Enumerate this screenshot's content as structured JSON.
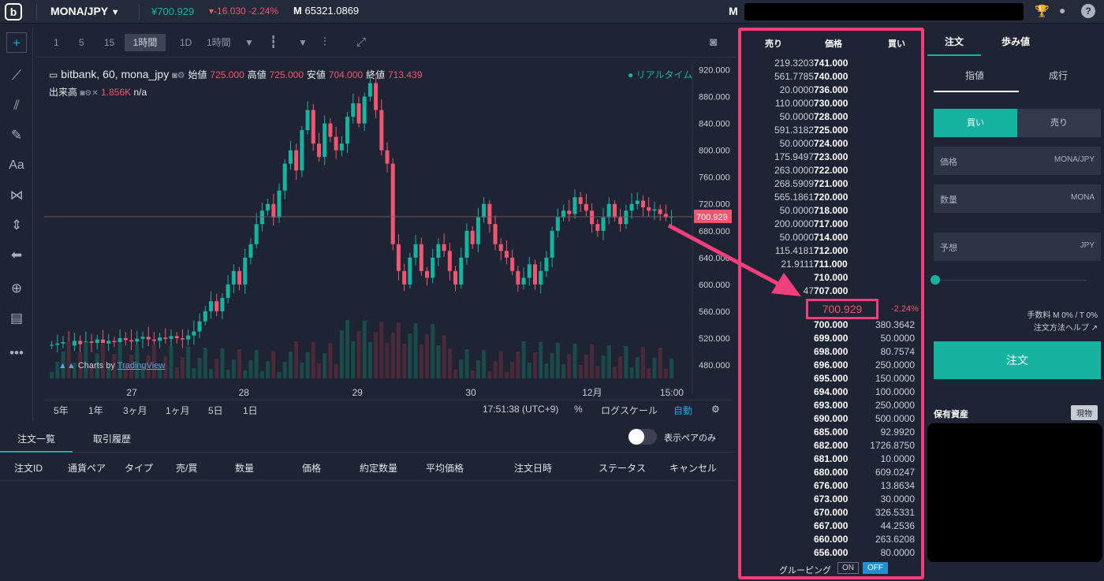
{
  "header": {
    "pair": "MONA/JPY",
    "price": "¥700.929",
    "change": "-16.030 -2.24%",
    "volume_prefix": "M",
    "volume": "65321.0869",
    "user_prefix": "M"
  },
  "chart_toolbar": {
    "timeframes": [
      "1",
      "5",
      "15",
      "1時間",
      "1D",
      "1時間"
    ],
    "active": "1時間"
  },
  "chart_legend": {
    "title": "bitbank, 60, mona_jpy",
    "open_label": "始値",
    "open": "725.000",
    "high_label": "高値",
    "high": "725.000",
    "low_label": "安値",
    "low": "704.000",
    "close_label": "終値",
    "close": "713.439",
    "volume_label": "出来高",
    "volume_value": "1.856K",
    "volume_extra": "n/a",
    "realtime": "● リアルタイム",
    "watermark": "Charts by",
    "watermark_link": "TradingView"
  },
  "chart_data": {
    "type": "candlestick",
    "y_ticks": [
      "920.000",
      "880.000",
      "840.000",
      "800.000",
      "760.000",
      "720.000",
      "680.000",
      "640.000",
      "600.000",
      "560.000",
      "520.000",
      "480.000"
    ],
    "ylim": [
      460,
      930
    ],
    "x_ticks": [
      "27",
      "28",
      "29",
      "30",
      "12月",
      "15:00"
    ],
    "current_price": "700.929",
    "closes": [
      510,
      512,
      514,
      509,
      516,
      511,
      515,
      513,
      518,
      512,
      516,
      514,
      520,
      517,
      515,
      519,
      522,
      518,
      516,
      521,
      519,
      523,
      520,
      518,
      524,
      530,
      545,
      560,
      575,
      560,
      580,
      600,
      620,
      600,
      640,
      660,
      690,
      710,
      720,
      700,
      740,
      780,
      800,
      770,
      830,
      860,
      810,
      790,
      840,
      820,
      800,
      810,
      850,
      870,
      840,
      880,
      900,
      860,
      800,
      780,
      660,
      620,
      600,
      640,
      660,
      620,
      610,
      640,
      660,
      650,
      620,
      600,
      640,
      680,
      660,
      700,
      720,
      690,
      660,
      650,
      640,
      620,
      600,
      610,
      630,
      600,
      620,
      640,
      680,
      700,
      710,
      705,
      730,
      720,
      710,
      690,
      680,
      700,
      720,
      700,
      690,
      710,
      720,
      725,
      715,
      710,
      712,
      705,
      700,
      701
    ]
  },
  "chart_bottom": {
    "ranges": [
      "5年",
      "1年",
      "3ヶ月",
      "1ヶ月",
      "5日",
      "1日"
    ],
    "clock": "17:51:38 (UTC+9)",
    "pct": "%",
    "log": "ログスケール",
    "auto": "自動"
  },
  "orders": {
    "tabs": [
      "注文一覧",
      "取引履歴"
    ],
    "toggle_label": "表示ペアのみ",
    "columns": [
      "注文ID",
      "通貨ペア",
      "タイプ",
      "売/買",
      "数量",
      "価格",
      "約定数量",
      "平均価格",
      "注文日時",
      "ステータス",
      "キャンセル"
    ]
  },
  "orderbook": {
    "headers": [
      "売り",
      "価格",
      "買い"
    ],
    "asks": [
      [
        "219.3203",
        "741.000"
      ],
      [
        "561.7785",
        "740.000"
      ],
      [
        "20.0000",
        "736.000"
      ],
      [
        "110.0000",
        "730.000"
      ],
      [
        "50.0000",
        "728.000"
      ],
      [
        "591.3182",
        "725.000"
      ],
      [
        "50.0000",
        "724.000"
      ],
      [
        "175.9497",
        "723.000"
      ],
      [
        "263.0000",
        "722.000"
      ],
      [
        "268.5909",
        "721.000"
      ],
      [
        "565.1861",
        "720.000"
      ],
      [
        "50.0000",
        "718.000"
      ],
      [
        "200.0000",
        "717.000"
      ],
      [
        "50.0000",
        "714.000"
      ],
      [
        "115.4181",
        "712.000"
      ],
      [
        "21.9111",
        "711.000"
      ],
      [
        "",
        "710.000"
      ],
      [
        "47",
        "707.000"
      ]
    ],
    "mid_price": "700.929",
    "mid_change": "-2.24%",
    "bids": [
      [
        "700.000",
        "380.3642"
      ],
      [
        "699.000",
        "50.0000"
      ],
      [
        "698.000",
        "80.7574"
      ],
      [
        "696.000",
        "250.0000"
      ],
      [
        "695.000",
        "150.0000"
      ],
      [
        "694.000",
        "100.0000"
      ],
      [
        "693.000",
        "250.0000"
      ],
      [
        "690.000",
        "500.0000"
      ],
      [
        "685.000",
        "92.9920"
      ],
      [
        "682.000",
        "1726.8750"
      ],
      [
        "681.000",
        "10.0000"
      ],
      [
        "680.000",
        "609.0247"
      ],
      [
        "676.000",
        "13.8634"
      ],
      [
        "673.000",
        "30.0000"
      ],
      [
        "670.000",
        "326.5331"
      ],
      [
        "667.000",
        "44.2536"
      ],
      [
        "660.000",
        "263.6208"
      ],
      [
        "656.000",
        "80.0000"
      ]
    ],
    "grouping_label": "グルーピング",
    "on": "ON",
    "off": "OFF"
  },
  "order_panel": {
    "tabs": [
      "注文",
      "歩み値"
    ],
    "subtabs": [
      "指値",
      "成行"
    ],
    "buy": "買い",
    "sell": "売り",
    "price_label": "価格",
    "price_unit": "MONA/JPY",
    "qty_label": "数量",
    "qty_unit": "MONA",
    "est_label": "予想",
    "est_unit": "JPY",
    "fee": "手数料 M 0% / T 0%",
    "help": "注文方法ヘルプ",
    "order_button": "注文",
    "assets_title": "保有資産",
    "genbutsu": "現物"
  },
  "colors": {
    "up": "#16b3a0",
    "down": "#f0566f",
    "highlight": "#f03f7a",
    "bg": "#1e2433"
  }
}
